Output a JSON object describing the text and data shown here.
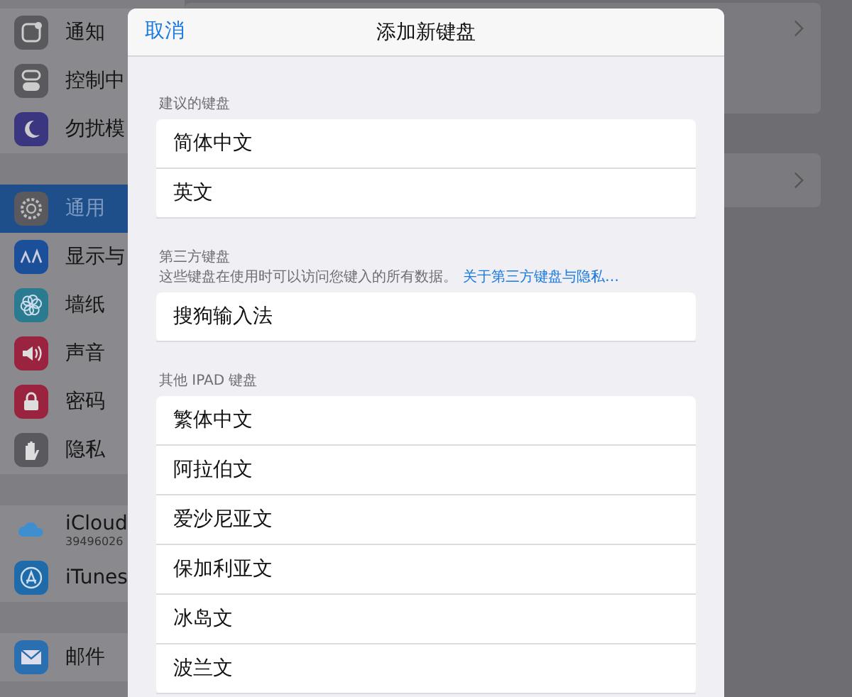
{
  "sidebar": {
    "groups": [
      {
        "items": [
          {
            "label": "通知",
            "selected": false
          },
          {
            "label": "控制中",
            "selected": false
          },
          {
            "label": "勿扰模",
            "selected": false
          }
        ]
      },
      {
        "items": [
          {
            "label": "通用",
            "selected": true
          },
          {
            "label": "显示与",
            "selected": false
          },
          {
            "label": "墙纸",
            "selected": false
          },
          {
            "label": "声音",
            "selected": false
          },
          {
            "label": "密码",
            "selected": false
          },
          {
            "label": "隐私",
            "selected": false
          }
        ]
      },
      {
        "items": [
          {
            "label": "iCloud",
            "subtitle": "39496026",
            "selected": false
          },
          {
            "label": "iTunes",
            "selected": false
          }
        ]
      },
      {
        "items": [
          {
            "label": "邮件",
            "selected": false
          }
        ]
      }
    ]
  },
  "modal": {
    "cancel": "取消",
    "title": "添加新键盘",
    "sections": [
      {
        "header": "建议的键盘",
        "rows": [
          "简体中文",
          "英文"
        ]
      },
      {
        "header": "第三方键盘",
        "note": "这些键盘在使用时可以访问您键入的所有数据。",
        "link": "关于第三方键盘与隐私…",
        "rows": [
          "搜狗输入法"
        ]
      },
      {
        "header": "其他 IPAD 键盘",
        "rows": [
          "繁体中文",
          "阿拉伯文",
          "爱沙尼亚文",
          "保加利亚文",
          "冰岛文",
          "波兰文"
        ]
      }
    ]
  }
}
